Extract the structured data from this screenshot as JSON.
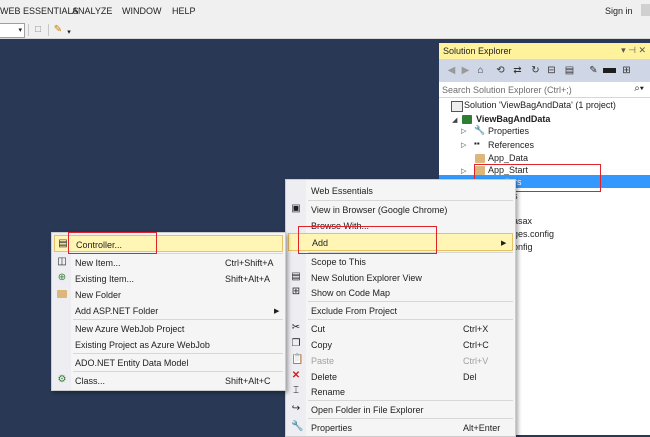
{
  "menubar": {
    "items": [
      "WEB ESSENTIALS",
      "ANALYZE",
      "WINDOW",
      "HELP"
    ],
    "signin": "Sign in"
  },
  "solution_explorer": {
    "title": "Solution Explorer",
    "title_controls": "▾ ⊣ ✕",
    "search_placeholder": "Search Solution Explorer (Ctrl+;)",
    "tree": {
      "solution": "Solution 'ViewBagAndData' (1 project)",
      "project": "ViewBagAndData",
      "properties": "Properties",
      "references": "References",
      "app_data": "App_Data",
      "app_start": "App_Start",
      "controllers_partial": "llers",
      "item_s": "s",
      "asax_partial": "asax",
      "config1_partial": "ges.config",
      "config2_partial": "onfig"
    }
  },
  "context_menu_right": {
    "items": [
      {
        "label": "Web Essentials",
        "shortcut": ""
      },
      {
        "label": "View in Browser (Google Chrome)",
        "shortcut": ""
      },
      {
        "label": "Browse With...",
        "shortcut": ""
      },
      {
        "label": "Add",
        "shortcut": ""
      },
      {
        "label": "Scope to This",
        "shortcut": ""
      },
      {
        "label": "New Solution Explorer View",
        "shortcut": ""
      },
      {
        "label": "Show on Code Map",
        "shortcut": ""
      },
      {
        "label": "Exclude From Project",
        "shortcut": ""
      },
      {
        "label": "Cut",
        "shortcut": "Ctrl+X"
      },
      {
        "label": "Copy",
        "shortcut": "Ctrl+C"
      },
      {
        "label": "Paste",
        "shortcut": "Ctrl+V"
      },
      {
        "label": "Delete",
        "shortcut": "Del"
      },
      {
        "label": "Rename",
        "shortcut": ""
      },
      {
        "label": "Open Folder in File Explorer",
        "shortcut": ""
      },
      {
        "label": "Properties",
        "shortcut": "Alt+Enter"
      }
    ]
  },
  "context_menu_add": {
    "items": [
      {
        "label": "Controller...",
        "shortcut": ""
      },
      {
        "label": "New Item...",
        "shortcut": "Ctrl+Shift+A"
      },
      {
        "label": "Existing Item...",
        "shortcut": "Shift+Alt+A"
      },
      {
        "label": "New Folder",
        "shortcut": ""
      },
      {
        "label": "Add ASP.NET Folder",
        "shortcut": ""
      },
      {
        "label": "New Azure WebJob Project",
        "shortcut": ""
      },
      {
        "label": "Existing Project as Azure WebJob",
        "shortcut": ""
      },
      {
        "label": "ADO.NET Entity Data Model",
        "shortcut": ""
      },
      {
        "label": "Class...",
        "shortcut": "Shift+Alt+C"
      }
    ]
  },
  "colors": {
    "background": "#293955",
    "menu_highlight": "#fff5b4",
    "annotation_red": "#e0222a",
    "selection": "#3399ff",
    "se_title": "#fff29d"
  }
}
